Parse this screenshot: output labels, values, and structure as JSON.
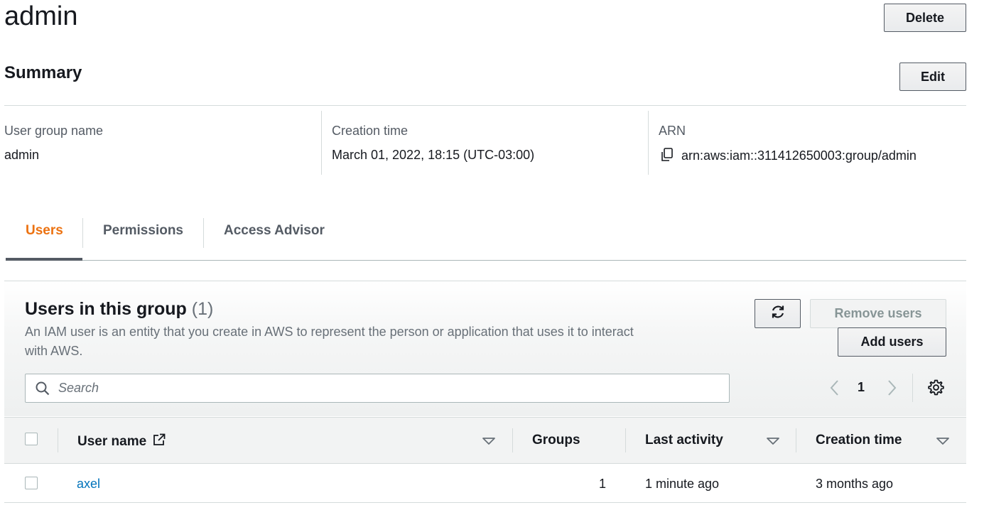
{
  "header": {
    "title": "admin",
    "delete_label": "Delete"
  },
  "summary": {
    "title": "Summary",
    "edit_label": "Edit",
    "fields": [
      {
        "label": "User group name",
        "value": "admin"
      },
      {
        "label": "Creation time",
        "value": "March 01, 2022, 18:15 (UTC-03:00)"
      },
      {
        "label": "ARN",
        "value": "arn:aws:iam::311412650003:group/admin"
      }
    ]
  },
  "tabs": [
    {
      "label": "Users",
      "active": true
    },
    {
      "label": "Permissions",
      "active": false
    },
    {
      "label": "Access Advisor",
      "active": false
    }
  ],
  "users_panel": {
    "title": "Users in this group",
    "count": "(1)",
    "description": "An IAM user is an entity that you create in AWS to represent the person or application that uses it to interact with AWS.",
    "remove_label": "Remove users",
    "add_label": "Add users",
    "search_placeholder": "Search",
    "current_page": "1",
    "columns": [
      "User name",
      "Groups",
      "Last activity",
      "Creation time"
    ],
    "rows": [
      {
        "user_name": "axel",
        "groups": "1",
        "last_activity": "1 minute ago",
        "creation_time": "3 months ago"
      }
    ]
  },
  "colors": {
    "accent": "#ec7211",
    "link": "#0073bb",
    "text": "#16191f",
    "muted": "#687078"
  },
  "icons": [
    "copy-icon",
    "refresh-icon",
    "search-icon",
    "chevron-left-icon",
    "chevron-right-icon",
    "settings-gear-icon",
    "external-link-icon",
    "sort-caret-down-icon"
  ]
}
